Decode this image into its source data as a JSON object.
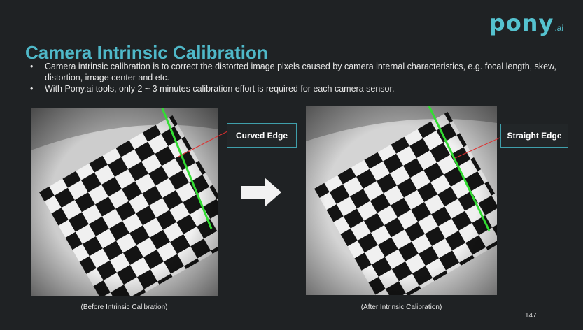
{
  "logo": {
    "main": "pony",
    "sub": ".ai"
  },
  "title": "Camera Intrinsic Calibration",
  "bullets": [
    "Camera intrinsic calibration is to correct the distorted image pixels caused by camera internal characteristics, e.g. focal length, skew, distortion, image center and etc.",
    "With Pony.ai tools, only 2 ~ 3 minutes calibration effort is required for each camera sensor."
  ],
  "left_panel": {
    "callout": "Curved Edge",
    "caption": "(Before Intrinsic Calibration)"
  },
  "right_panel": {
    "callout": "Straight Edge",
    "caption": "(After Intrinsic Calibration)"
  },
  "page_number": "147",
  "colors": {
    "background": "#1f2224",
    "title": "#4fb8c8",
    "callout_border": "#3f9fab",
    "edge_line": "#33dd33",
    "pointer": "#e03030"
  },
  "icons": {
    "transition": "right-arrow-icon"
  }
}
